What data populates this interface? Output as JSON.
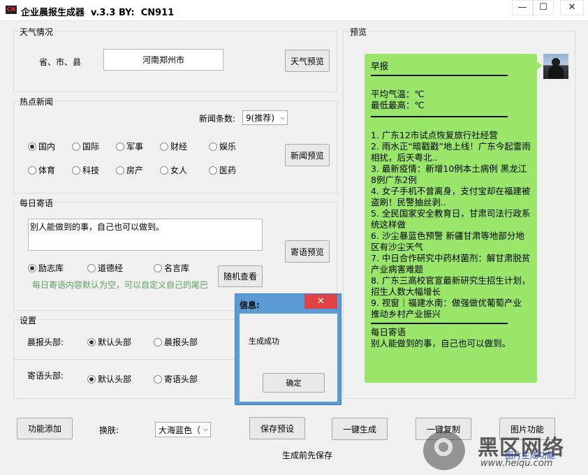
{
  "window": {
    "icon_text": "CN",
    "title": "企业晨报生成器  v.3.3 BY:  CN911",
    "minimize_glyph": "—",
    "maximize_glyph": "☐",
    "close_glyph": "✕"
  },
  "weather": {
    "group_title": "天气情况",
    "location_label": "省、市、县",
    "location_value": "河南郑州市",
    "preview_button": "天气预览"
  },
  "news": {
    "group_title": "热点新闻",
    "count_label": "新闻条数:",
    "count_value": "9(推荐)",
    "categories": [
      "国内",
      "国际",
      "军事",
      "财经",
      "娱乐",
      "体育",
      "科技",
      "房产",
      "女人",
      "医药"
    ],
    "selected_category": "国内",
    "preview_button": "新闻预览"
  },
  "daily_quote": {
    "group_title": "每日寄语",
    "text": "别人能做到的事，自己也可以做到。",
    "preview_button": "寄语预览",
    "sources": [
      "励志库",
      "道德经",
      "名言库"
    ],
    "selected_source": "励志库",
    "random_button": "随机查看",
    "hint": "每日寄语内容默认为空，可以自定义自己的尾巴"
  },
  "settings": {
    "group_title": "设置",
    "morning_header_label": "晨报头部:",
    "morning_header_options": [
      "默认头部",
      "晨报头部"
    ],
    "quote_header_label": "寄语头部:",
    "quote_header_options": [
      "默认头部",
      "寄语头部"
    ],
    "selected": "默认头部"
  },
  "preview": {
    "group_title": "预览",
    "heading": "早报",
    "avg_temp": "平均气温：℃",
    "min_max": "最低最高：℃",
    "news_items": [
      "1. 广东12市试点恢复旅行社经营",
      "2. 雨水正“暗戳戳”地上线！广东今起雷雨相扰，后天粤北..",
      "3. 最新疫情：新增10例本土病例  黑龙江8例广东2例",
      "4. 女子手机不曾离身，支付宝却在福建被盗刷！民警抽丝剥..",
      "5. 全民国家安全教育日，甘肃司法行政系统这样做",
      "6. 沙尘暴蓝色预警  新疆甘肃等地部分地区有沙尘天气",
      "7. 中日合作研究中药材菌剂：解甘肃脱贫产业病害难题",
      "8. 广东三高校官宣最新研究生招生计划，招生人数大幅增长",
      "9. 视窗｜福建水南：做强做优葡萄产业  推动乡村产业振兴"
    ],
    "quote_heading": "每日寄语",
    "quote_text": "别人能做到的事，自己也可以做到。"
  },
  "dialog": {
    "title": "信息:",
    "message": "生成成功",
    "ok_button": "确定",
    "close_glyph": "✕"
  },
  "bottom": {
    "add_feature_button": "功能添加",
    "skin_label": "换肤:",
    "skin_value": "大海蓝色（",
    "save_preset_button": "保存预设",
    "generate_button": "一键生成",
    "copy_button": "一键复制",
    "image_button": "图片功能",
    "save_hint": "生成前先保存"
  },
  "watermark": {
    "brand": "黑区网络",
    "url": "www.heiqu.com",
    "overlay_text": "图片生成功能"
  },
  "colors": {
    "bubble_green": "#99e66a",
    "hint_green": "#5aa05a",
    "dialog_blue": "#5b9bd5",
    "close_red": "#e04343"
  }
}
